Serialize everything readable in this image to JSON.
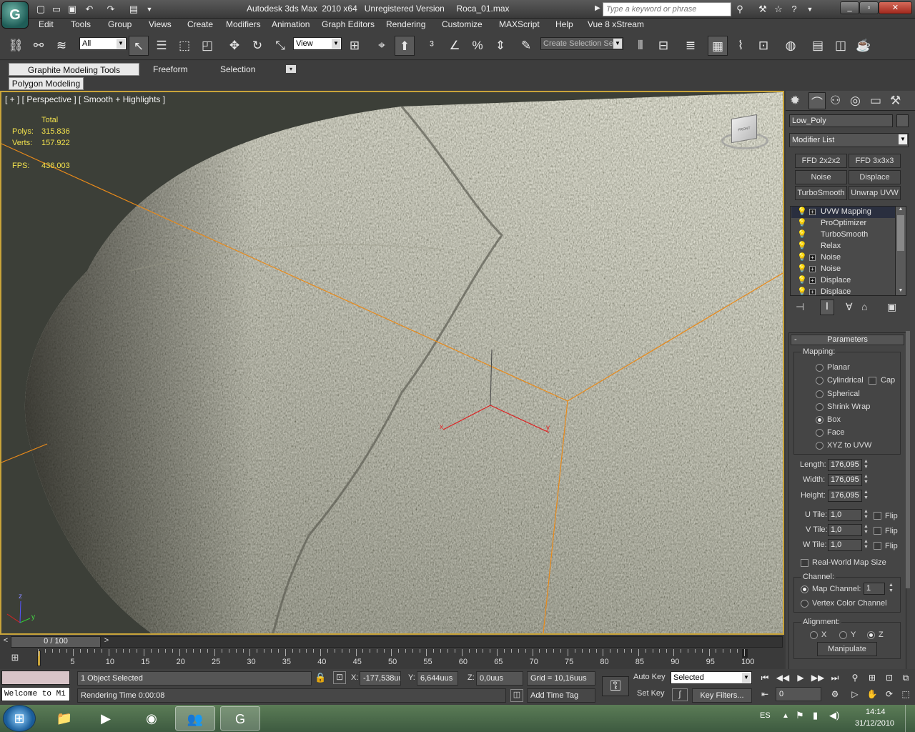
{
  "app": {
    "title": "Autodesk 3ds Max  2010 x64   Unregistered Version     Roca_01.max",
    "search_placeholder": "Type a keyword or phrase",
    "logo": "3ds-max-logo"
  },
  "menu": [
    "Edit",
    "Tools",
    "Group",
    "Views",
    "Create",
    "Modifiers",
    "Animation",
    "Graph Editors",
    "Rendering",
    "Customize",
    "MAXScript",
    "Help",
    "Vue 8 xStream"
  ],
  "toolbar": {
    "selection_filter": "All",
    "ref_coord": "View",
    "named_selection_placeholder": "Create Selection Se"
  },
  "ribbon": {
    "tabs": [
      "Graphite Modeling Tools",
      "Freeform",
      "Selection"
    ],
    "sub": "Polygon Modeling"
  },
  "viewport": {
    "label": "[ + ] [ Perspective ] [ Smooth + Highlights ]",
    "stats_header": "Total",
    "polys_label": "Polys:",
    "polys": "315.836",
    "verts_label": "Verts:",
    "verts": "157.922",
    "fps_label": "FPS:",
    "fps": "436.003",
    "axis_x": "x",
    "axis_y": "y",
    "axis_z": "z",
    "viewcube_front": "FRONT",
    "viewcube_side": "LEFT"
  },
  "command_panel": {
    "object_name": "Low_Poly",
    "modifier_list": "Modifier List",
    "buttons": [
      "FFD 2x2x2",
      "FFD 3x3x3",
      "Noise",
      "Displace",
      "TurboSmooth",
      "Unwrap UVW"
    ],
    "stack": [
      {
        "label": "UVW Mapping",
        "plus": true,
        "selected": true
      },
      {
        "label": "ProOptimizer",
        "plus": false,
        "selected": false
      },
      {
        "label": "TurboSmooth",
        "plus": false,
        "selected": false
      },
      {
        "label": "Relax",
        "plus": false,
        "selected": false
      },
      {
        "label": "Noise",
        "plus": true,
        "selected": false
      },
      {
        "label": "Noise",
        "plus": true,
        "selected": false
      },
      {
        "label": "Displace",
        "plus": true,
        "selected": false
      },
      {
        "label": "Displace",
        "plus": true,
        "selected": false
      }
    ],
    "rollout_title": "Parameters",
    "rollout_minus": "-",
    "mapping_label": "Mapping:",
    "mapping_options": [
      "Planar",
      "Cylindrical",
      "Spherical",
      "Shrink Wrap",
      "Box",
      "Face",
      "XYZ to UVW"
    ],
    "mapping_selected": "Box",
    "cap_label": "Cap",
    "length_label": "Length:",
    "length": "176,095",
    "width_label": "Width:",
    "width": "176,095",
    "height_label": "Height:",
    "height": "176,095",
    "utile_label": "U Tile:",
    "utile": "1,0",
    "vtile_label": "V Tile:",
    "vtile": "1,0",
    "wtile_label": "W Tile:",
    "wtile": "1,0",
    "flip_label": "Flip",
    "realworld_label": "Real-World Map Size",
    "channel_label": "Channel:",
    "map_channel_label": "Map Channel:",
    "map_channel": "1",
    "vertex_color_label": "Vertex Color Channel",
    "alignment_label": "Alignment:",
    "align_x": "X",
    "align_y": "Y",
    "align_z": "Z",
    "manipulate_label": "Manipulate"
  },
  "timeline": {
    "frame_display": "0 / 100",
    "prev": "<",
    "next": ">",
    "ticks": [
      "5",
      "10",
      "15",
      "20",
      "25",
      "30",
      "35",
      "40",
      "45",
      "50",
      "55",
      "60",
      "65",
      "70",
      "75",
      "80",
      "85",
      "90",
      "95",
      "100"
    ]
  },
  "status": {
    "maxscript_prompt": "Welcome to Mi",
    "selected_text": "1 Object Selected",
    "render_time": "Rendering Time  0:00:08",
    "x_label": "X:",
    "x": "-177,538uu",
    "y_label": "Y:",
    "y": "6,644uus",
    "z_label": "Z:",
    "z": "0,0uus",
    "grid": "Grid = 10,16uus",
    "add_time_tag": "Add Time Tag",
    "auto_key": "Auto Key",
    "set_key": "Set Key",
    "key_mode": "Selected",
    "key_filters": "Key Filters...",
    "current_frame": "0"
  },
  "taskbar": {
    "lang": "ES",
    "time": "14:14",
    "date": "31/12/2010",
    "apps": [
      "windows-start",
      "file-explorer",
      "media-player",
      "firefox",
      "messenger",
      "3ds-max"
    ]
  },
  "colors": {
    "selection_line": "#e88a1a",
    "viewport_border": "#c9a43a",
    "stats_text": "#f2e24d",
    "stack_selected": "#2a2f3f"
  }
}
